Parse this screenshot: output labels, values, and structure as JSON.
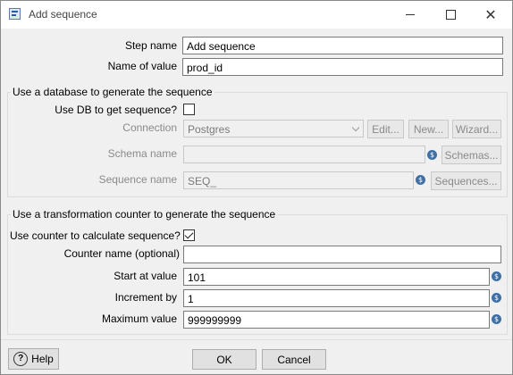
{
  "window": {
    "title": "Add sequence"
  },
  "fields": {
    "step_name": {
      "label": "Step name",
      "value": "Add sequence"
    },
    "name_of_value": {
      "label": "Name of value",
      "value": "prod_id"
    }
  },
  "db_group": {
    "title": "Use a database to generate the sequence",
    "use_db_label": "Use DB to get sequence?",
    "use_db_checked": false,
    "connection_label": "Connection",
    "connection_value": "Postgres",
    "edit_label": "Edit...",
    "new_label": "New...",
    "wizard_label": "Wizard...",
    "schema_label": "Schema name",
    "schema_value": "",
    "schemas_button": "Schemas...",
    "sequence_label": "Sequence name",
    "sequence_value": "SEQ_",
    "sequences_button": "Sequences..."
  },
  "counter_group": {
    "title": "Use a transformation counter to generate the sequence",
    "use_counter_label": "Use counter to calculate sequence?",
    "use_counter_checked": true,
    "counter_name_label": "Counter name (optional)",
    "counter_name_value": "",
    "start_label": "Start at value",
    "start_value": "101",
    "increment_label": "Increment by",
    "increment_value": "1",
    "max_label": "Maximum value",
    "max_value": "999999999"
  },
  "footer": {
    "help_label": "Help",
    "ok_label": "OK",
    "cancel_label": "Cancel"
  },
  "icons": {
    "variable": "dollar-variable-icon",
    "help": "question-circle-icon"
  }
}
